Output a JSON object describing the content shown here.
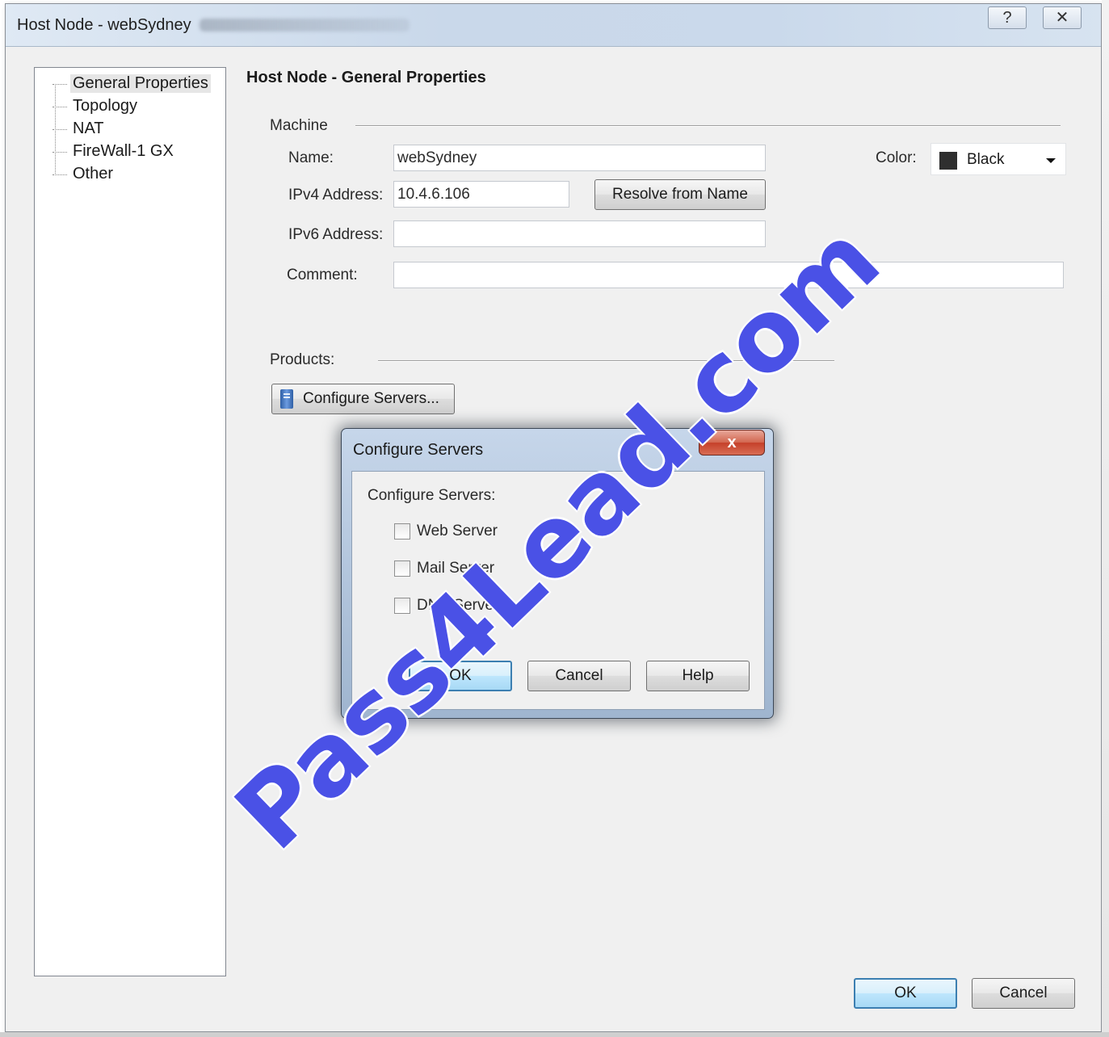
{
  "window": {
    "title": "Host Node - webSydney",
    "help_button": "?",
    "close_button": "✕"
  },
  "tree": {
    "items": [
      {
        "label": "General Properties"
      },
      {
        "label": "Topology"
      },
      {
        "label": "NAT"
      },
      {
        "label": "FireWall-1 GX"
      },
      {
        "label": "Other"
      }
    ]
  },
  "page": {
    "heading": "Host Node - General Properties",
    "machine_label": "Machine",
    "name_label": "Name:",
    "name_value": "webSydney",
    "ipv4_label": "IPv4 Address:",
    "ipv4_value": "10.4.6.106",
    "resolve_button": "Resolve from Name",
    "ipv6_label": "IPv6 Address:",
    "ipv6_value": "",
    "comment_label": "Comment:",
    "comment_value": "",
    "color_label": "Color:",
    "color_value": "Black",
    "color_swatch": "#2f2f2f",
    "products_label": "Products:",
    "configure_servers_button": "Configure Servers...",
    "configure_servers_icon": "server-icon"
  },
  "modal": {
    "title": "Configure Servers",
    "close_button": "x",
    "group_label": "Configure Servers:",
    "checkboxes": [
      {
        "label": "Web Server",
        "checked": false
      },
      {
        "label": "Mail Server",
        "checked": false
      },
      {
        "label": "DNS Server",
        "checked": false
      }
    ],
    "ok_button": "OK",
    "cancel_button": "Cancel",
    "help_button": "Help"
  },
  "footer": {
    "ok_button": "OK",
    "cancel_button": "Cancel"
  },
  "watermark": {
    "text": "Pass4Lead.com",
    "color": "#4a51e6"
  }
}
